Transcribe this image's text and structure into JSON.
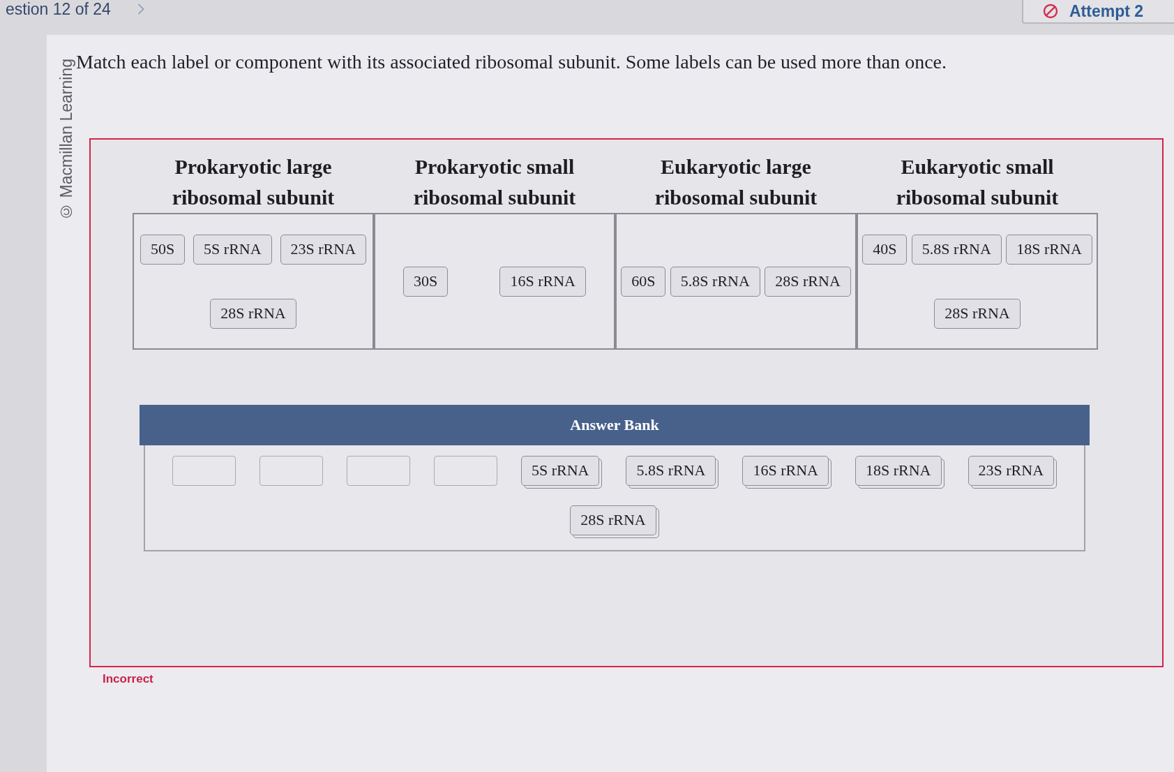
{
  "header": {
    "question_counter": "estion 12 of 24",
    "attempt": "Attempt 2"
  },
  "credit": "© Macmillan Learning",
  "prompt": "Match each label or component with its associated ribosomal subunit. Some labels can be used more than once.",
  "targets": [
    {
      "title": "Prokaryotic large ribosomal subunit",
      "labels": [
        "50S",
        "5S rRNA",
        "23S rRNA",
        "28S rRNA"
      ]
    },
    {
      "title": "Prokaryotic small ribosomal subunit",
      "labels": [
        "30S",
        "16S rRNA"
      ]
    },
    {
      "title": "Eukaryotic large ribosomal subunit",
      "labels": [
        "60S",
        "5.8S rRNA",
        "28S rRNA"
      ]
    },
    {
      "title": "Eukaryotic small ribosomal subunit",
      "labels": [
        "40S",
        "5.8S rRNA",
        "18S rRNA",
        "28S rRNA"
      ]
    }
  ],
  "answer_bank": {
    "title": "Answer Bank",
    "items": [
      {
        "kind": "empty"
      },
      {
        "kind": "empty"
      },
      {
        "kind": "empty"
      },
      {
        "kind": "empty"
      },
      {
        "kind": "stack",
        "label": "5S rRNA"
      },
      {
        "kind": "stack",
        "label": "5.8S rRNA"
      },
      {
        "kind": "stack",
        "label": "16S rRNA"
      },
      {
        "kind": "stack",
        "label": "18S rRNA"
      },
      {
        "kind": "stack",
        "label": "23S rRNA"
      },
      {
        "kind": "stack",
        "label": "28S rRNA"
      }
    ]
  },
  "result": {
    "correct": false,
    "text": "Incorrect"
  }
}
